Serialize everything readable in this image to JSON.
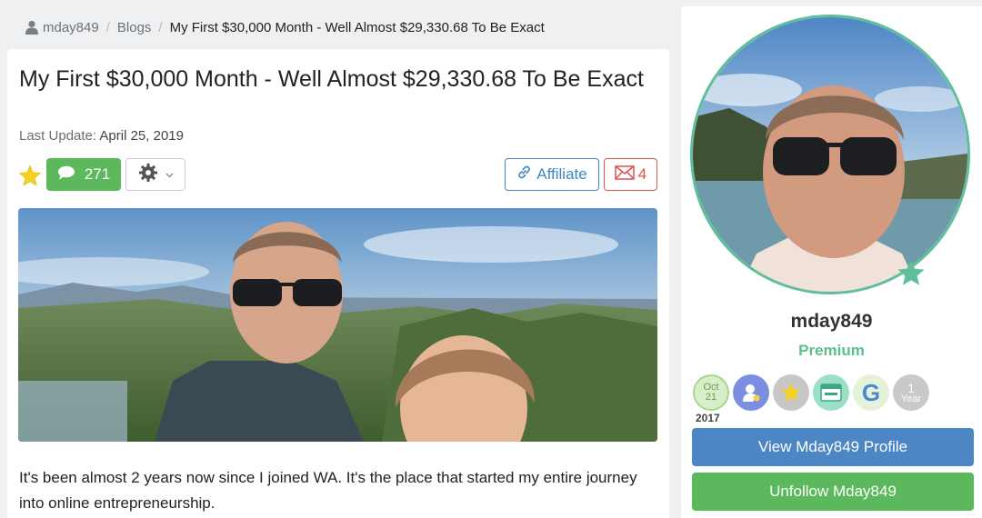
{
  "breadcrumb": {
    "user": "mday849",
    "sep": "/",
    "section": "Blogs",
    "current": "My First $30,000 Month - Well Almost $29,330.68 To Be Exact"
  },
  "post": {
    "title": "My First $30,000 Month - Well Almost $29,330.68 To Be Exact",
    "last_update_label": "Last Update:",
    "last_update_date": "April 25, 2019",
    "comments_count": "271",
    "affiliate_label": "Affiliate",
    "mail_count": "4",
    "photo_icon": "selfie-photo",
    "body": "It's been almost 2 years now since I joined WA. It's the place that started my entire journey into online entrepreneurship."
  },
  "profile": {
    "avatar_icon": "profile-photo",
    "username": "mday849",
    "level": "Premium",
    "badges": {
      "join_month": "Oct",
      "join_day": "21",
      "join_year": "2017",
      "google_letter": "G",
      "years_number": "1",
      "years_label": "Year"
    },
    "view_profile_label": "View Mday849 Profile",
    "unfollow_label": "Unfollow Mday849"
  },
  "colors": {
    "green": "#5cb85c",
    "blue": "#4d86c5",
    "red": "#d9534f",
    "teal": "#5fbf9b"
  }
}
